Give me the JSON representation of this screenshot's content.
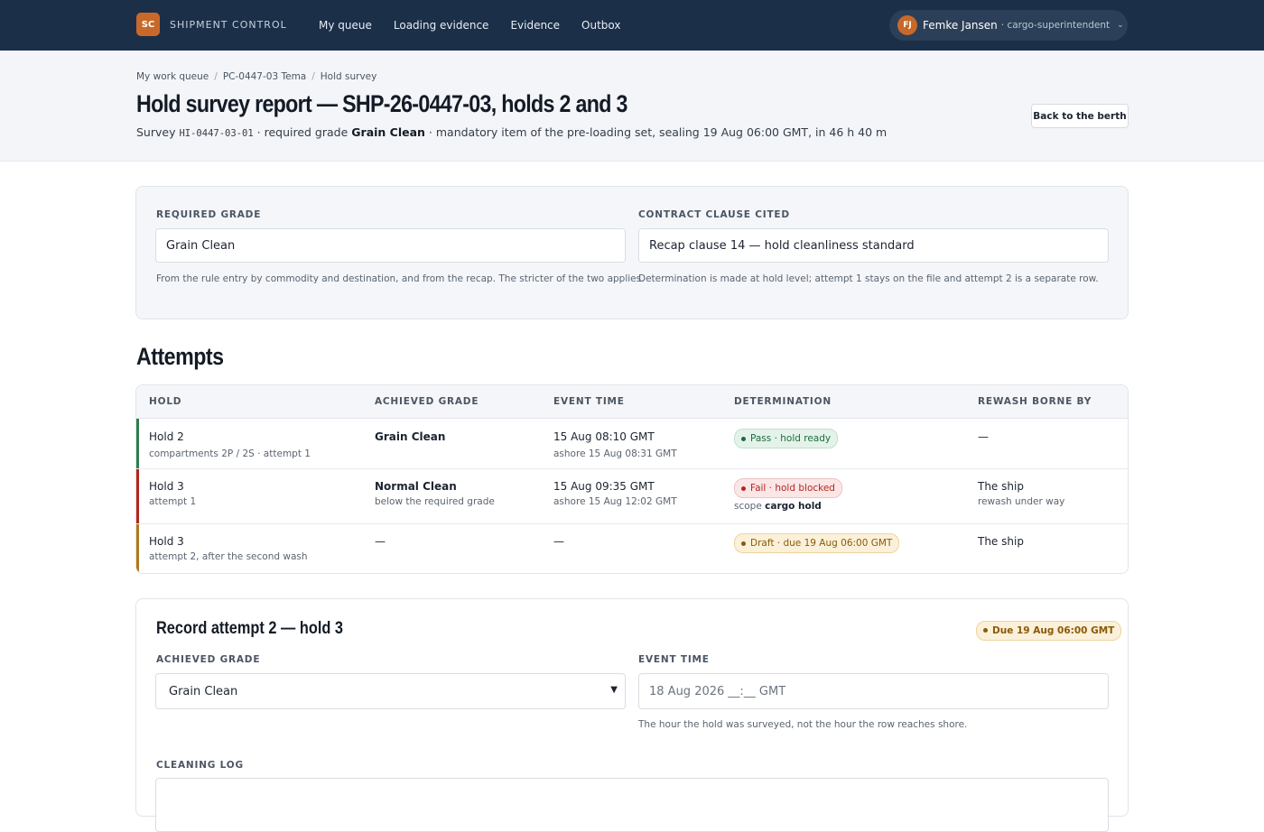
{
  "app": {
    "logo_initials": "SC",
    "name": "SHIPMENT CONTROL",
    "nav": [
      "My queue",
      "Loading evidence",
      "Evidence",
      "Outbox"
    ],
    "user": {
      "initials": "FJ",
      "name": "Femke Jansen",
      "role": "· cargo-superintendent",
      "chevron": "⌄"
    }
  },
  "breadcrumb": [
    "My work queue",
    "PC-0447-03 Tema",
    "Hold survey"
  ],
  "page": {
    "title": "Hold survey report — SHP-26-0447-03, holds 2 and 3",
    "subtitle_prefix": "Survey ",
    "survey_id": "HI-0447-03-01",
    "subtitle_mid": " · required grade ",
    "required_grade": "Grain Clean",
    "subtitle_suffix": " · mandatory item of the pre-loading set, sealing 19 Aug 06:00 GMT, in 46 h 40 m",
    "back_button": "Back to the berth"
  },
  "grade_panel": {
    "required_label": "REQUIRED GRADE",
    "required_value": "Grain Clean",
    "required_hint": "From the rule entry by commodity and destination, and from the recap. The stricter of the two applies.",
    "clause_label": "CONTRACT CLAUSE CITED",
    "clause_value": "Recap clause 14 — hold cleanliness standard",
    "clause_hint": "Determination is made at hold level; attempt 1 stays on the file and attempt 2 is a separate row."
  },
  "attempts": {
    "heading": "Attempts",
    "columns": [
      "HOLD",
      "ACHIEVED GRADE",
      "EVENT TIME",
      "DETERMINATION",
      "REWASH BORNE BY"
    ],
    "rows": [
      {
        "hold": "Hold 2",
        "hold_sub": "compartments 2P / 2S · attempt 1",
        "grade": "Grain Clean",
        "grade_sub": "",
        "time": "15 Aug 08:10 GMT",
        "time_sub": "ashore 15 Aug 08:31 GMT",
        "determination": "Pass · hold ready",
        "det_status": "pass",
        "det_sub_prefix": "",
        "det_sub_bold": "",
        "rewash": "—",
        "rewash_sub": "",
        "accent": "#2f7d4f"
      },
      {
        "hold": "Hold 3",
        "hold_sub": "attempt 1",
        "grade": "Normal Clean",
        "grade_sub": "below the required grade",
        "time": "15 Aug 09:35 GMT",
        "time_sub": "ashore 15 Aug 12:02 GMT",
        "determination": "Fail · hold blocked",
        "det_status": "fail",
        "det_sub_prefix": "scope ",
        "det_sub_bold": "cargo hold",
        "rewash": "The ship",
        "rewash_sub": "rewash under way",
        "accent": "#b3261e"
      },
      {
        "hold": "Hold 3",
        "hold_sub": "attempt 2, after the second wash",
        "grade": "—",
        "grade_sub": "",
        "time": "—",
        "time_sub": "",
        "determination": "Draft · due 19 Aug 06:00 GMT",
        "det_status": "draft",
        "det_sub_prefix": "",
        "det_sub_bold": "",
        "rewash": "The ship",
        "rewash_sub": "",
        "accent": "#b07a1a"
      }
    ]
  },
  "record_form": {
    "title": "Record attempt 2 — hold 3",
    "due_badge": "Due 19 Aug 06:00 GMT",
    "grade_label": "ACHIEVED GRADE",
    "grade_value": "Grain Clean",
    "time_label": "EVENT TIME",
    "time_placeholder": "18 Aug 2026 __:__ GMT",
    "time_hint": "The hour the hold was surveyed, not the hour the row reaches shore.",
    "log_label": "CLEANING LOG"
  },
  "colors": {
    "topbar": "#1b2f49",
    "brand": "#c8692a",
    "pass": "#1f6a3e",
    "fail": "#b3261e",
    "draft": "#8a5a08"
  }
}
